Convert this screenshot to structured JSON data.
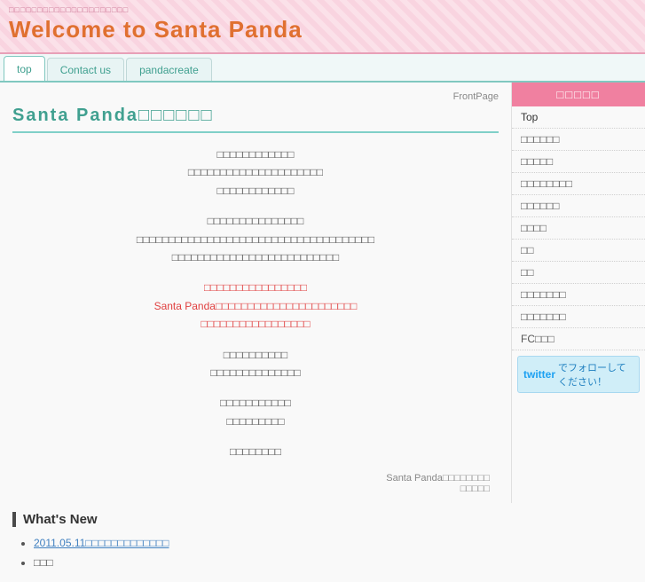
{
  "header": {
    "small_text": "□□□□□□□□□□□□□□□□□□□□□",
    "site_title": "Welcome to Santa Panda"
  },
  "nav": {
    "tabs": [
      {
        "label": "top",
        "active": true
      },
      {
        "label": "Contact us",
        "active": false
      },
      {
        "label": "pandacreate",
        "active": false
      }
    ]
  },
  "main": {
    "front_page_label": "FrontPage",
    "page_heading": "Santa Panda□□□□□□",
    "blocks": [
      {
        "id": "block1",
        "lines": [
          "□□□□□□□□□□□□",
          "□□□□□□□□□□□□□□□□□□□□□",
          "□□□□□□□□□□□□"
        ]
      },
      {
        "id": "block2",
        "lines": [
          "□□□□□□□□□□□□□□□",
          "□□□□□□□□□□□□□□□□□□□□□□□□□□□□□□□□□□□□□",
          "□□□□□□□□□□□□□□□□□□□□□□□□□□"
        ]
      },
      {
        "id": "block3",
        "type": "red",
        "lines": [
          "□□□□□□□□□□□□□□□□"
        ],
        "mixed_line": "Santa Panda□□□□□□□□□□□□□□□□□□□□□□",
        "last_line": "□□□□□□□□□□□□□□□□□"
      },
      {
        "id": "block4",
        "lines": [
          "□□□□□□□□□□",
          "□□□□□□□□□□□□□□"
        ]
      },
      {
        "id": "block5",
        "lines": [
          "□□□□□□□□□□□",
          "□□□□□□□□□"
        ]
      },
      {
        "id": "block6",
        "lines": [
          "□□□□□□□□"
        ]
      }
    ],
    "image_caption": "Santa Panda□□□□□□□□\n□□□□□"
  },
  "whats_new": {
    "title": "What's New",
    "items": [
      {
        "text": "2011.05.11□□□□□□□□□□□□□"
      },
      {
        "text": "□□□"
      }
    ]
  },
  "sidebar": {
    "title": "□□□□□",
    "items": [
      {
        "label": "Top"
      },
      {
        "label": "□□□□□□"
      },
      {
        "label": "□□□□□"
      },
      {
        "label": "□□□□□□□□"
      },
      {
        "label": "□□□□□□"
      },
      {
        "label": "□□□□"
      },
      {
        "label": "□□"
      },
      {
        "label": "□□"
      },
      {
        "label": "□□□□□□□"
      },
      {
        "label": "□□□□□□□"
      },
      {
        "label": "FC□□□"
      }
    ],
    "twitter_label": "でフォローしてください！"
  }
}
